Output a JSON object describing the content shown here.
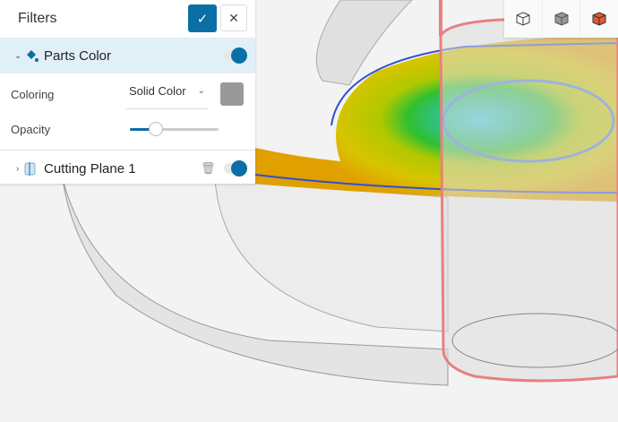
{
  "panel": {
    "title": "Filters",
    "confirm_icon": "check-icon",
    "close_icon": "close-icon",
    "filters": [
      {
        "name": "Parts Color",
        "enabled": true,
        "expanded": true,
        "coloring_label": "Coloring",
        "coloring_value": "Solid Color",
        "color": "#999999",
        "opacity_label": "Opacity",
        "opacity": 0.29
      },
      {
        "name": "Cutting Plane 1",
        "enabled": true,
        "expanded": false
      }
    ]
  },
  "view_toolbar": [
    "wireframe-cube-icon",
    "solid-cube-icon",
    "colored-cube-icon"
  ],
  "colors": {
    "accent": "#0a6fa6",
    "selected_row": "#e1eff7"
  }
}
